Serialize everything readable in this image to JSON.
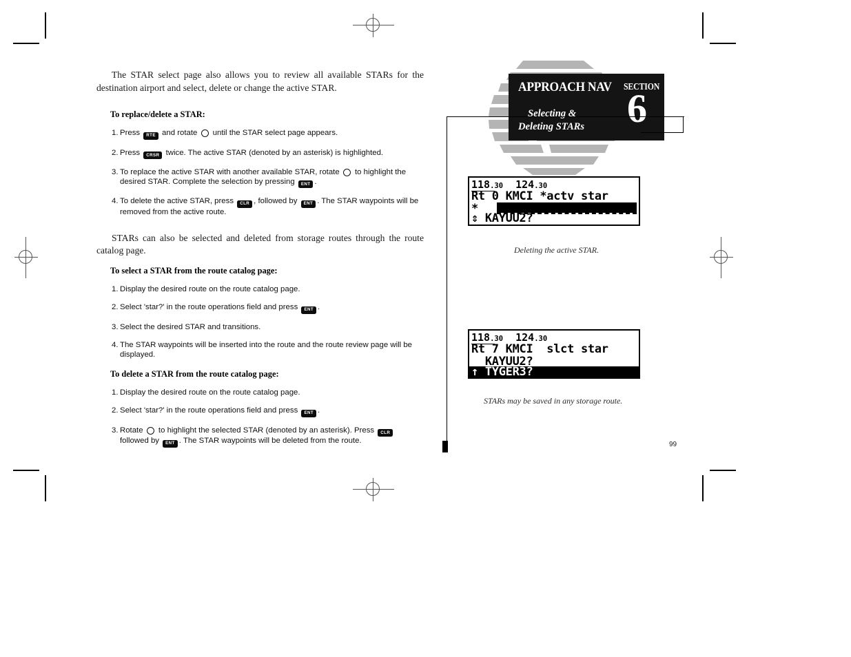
{
  "document": {
    "page_number": "99",
    "section_header": {
      "title": "APPROACH NAV",
      "subtitle_line1": "Selecting &",
      "subtitle_line2": "Deleting STARs",
      "section_word": "SECTION",
      "section_number": "6"
    }
  },
  "body": {
    "intro_paragraph": "The STAR select page also allows you to review all available STARs for the destination airport and select, delete or change the active STAR.",
    "heading_replace_delete": "To replace/delete a STAR:",
    "steps_replace_delete": [
      {
        "num": "1.",
        "parts": [
          {
            "type": "text",
            "value": "Press "
          },
          {
            "type": "key",
            "value": "RTE"
          },
          {
            "type": "text",
            "value": " and rotate "
          },
          {
            "type": "knob",
            "value": "rotate-knob"
          },
          {
            "type": "text",
            "value": " until the STAR select page appears."
          }
        ]
      },
      {
        "num": "2.",
        "parts": [
          {
            "type": "text",
            "value": "Press "
          },
          {
            "type": "key",
            "value": "CRSR"
          },
          {
            "type": "text",
            "value": " twice. The active STAR (denoted by an asterisk) is highlighted."
          }
        ]
      },
      {
        "num": "3.",
        "parts": [
          {
            "type": "text",
            "value": "To replace the active STAR with another available STAR, rotate "
          },
          {
            "type": "knob",
            "value": "rotate-knob"
          },
          {
            "type": "text",
            "value": " to highlight the desired STAR. Complete the selection by pressing "
          },
          {
            "type": "key",
            "value": "ENT"
          },
          {
            "type": "text",
            "value": "."
          }
        ]
      },
      {
        "num": "4.",
        "parts": [
          {
            "type": "text",
            "value": "To delete the active STAR, press "
          },
          {
            "type": "key",
            "value": "CLR"
          },
          {
            "type": "text",
            "value": ", followed by "
          },
          {
            "type": "key",
            "value": "ENT"
          },
          {
            "type": "text",
            "value": ". The STAR waypoints will be removed from the active route."
          }
        ]
      }
    ],
    "mid_paragraph": "STARs can also be selected and deleted from storage routes through the route catalog page.",
    "heading_select_catalog": "To select a STAR from the route catalog page:",
    "steps_select_catalog": [
      {
        "num": "1.",
        "parts": [
          {
            "type": "text",
            "value": "Display the desired route on the route catalog page."
          }
        ]
      },
      {
        "num": "2.",
        "parts": [
          {
            "type": "text",
            "value": "Select 'star?' in the route operations field and press "
          },
          {
            "type": "key",
            "value": "ENT"
          },
          {
            "type": "text",
            "value": "."
          }
        ]
      },
      {
        "num": "3.",
        "parts": [
          {
            "type": "text",
            "value": "Select the desired STAR and transitions."
          }
        ]
      },
      {
        "num": "4.",
        "parts": [
          {
            "type": "text",
            "value": "The STAR waypoints will be inserted into the route and the route review page will be displayed."
          }
        ]
      }
    ],
    "heading_delete_catalog": "To delete a STAR from the route catalog page:",
    "steps_delete_catalog": [
      {
        "num": "1.",
        "parts": [
          {
            "type": "text",
            "value": "Display the desired route on the route catalog page."
          }
        ]
      },
      {
        "num": "2.",
        "parts": [
          {
            "type": "text",
            "value": "Select 'star?' in the route operations field and press "
          },
          {
            "type": "key",
            "value": "ENT"
          },
          {
            "type": "text",
            "value": "."
          }
        ]
      },
      {
        "num": "3.",
        "parts": [
          {
            "type": "text",
            "value": "Rotate "
          },
          {
            "type": "knob",
            "value": "rotate-knob"
          },
          {
            "type": "text",
            "value": " to highlight the selected STAR (denoted by an asterisk). Press "
          },
          {
            "type": "key",
            "value": "CLR"
          },
          {
            "type": "text",
            "value": " followed by "
          },
          {
            "type": "key",
            "value": "ENT"
          },
          {
            "type": "text",
            "value": ". The STAR waypoints will be deleted from the route."
          }
        ]
      }
    ]
  },
  "figures": [
    {
      "id": "lcd-delete-active-star",
      "caption": "Deleting the active STAR.",
      "freq_left_main": "118",
      "freq_left_dec": ".30",
      "freq_right_main": "124",
      "freq_right_dec": ".30",
      "line2": "Rt 0 KMCI *actv star",
      "line3_prefix": "*",
      "line3_highlight": "",
      "line4_arrow": "⇕",
      "line4_text": "KAYUU2?"
    },
    {
      "id": "lcd-select-star-storage-route",
      "caption": "STARs may be saved in any storage route.",
      "freq_left_main": "118",
      "freq_left_dec": ".30",
      "freq_right_main": "124",
      "freq_right_dec": ".30",
      "line2": "Rt 7 KMCI  slct star",
      "line3": "  KAYUU2?",
      "line4_arrow": "↑",
      "line4_text": "TYGER3?"
    }
  ],
  "colors": {
    "ink": "#000000",
    "header_box": "#141414",
    "watermark_grey": "#b3b3b3",
    "caption_grey": "#2a2a2a"
  }
}
